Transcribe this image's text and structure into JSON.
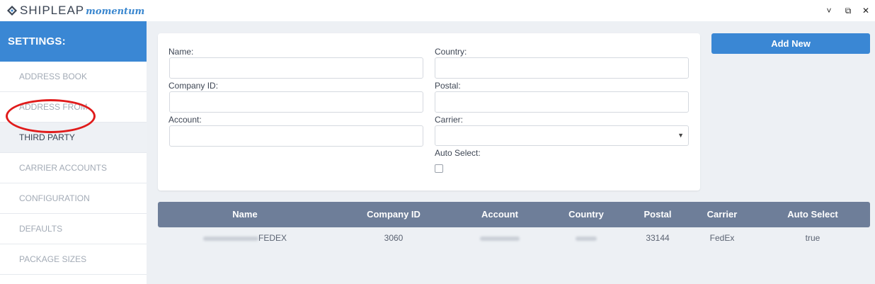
{
  "app": {
    "brand": "SHIPLEAP",
    "brand_sub": "momentum",
    "window_controls": {
      "minimize": "˅",
      "restore": "⧉",
      "close": "✕"
    }
  },
  "sidebar": {
    "title": "SETTINGS:",
    "items": [
      {
        "label": "ADDRESS BOOK"
      },
      {
        "label": "ADDRESS FROM"
      },
      {
        "label": "THIRD PARTY"
      },
      {
        "label": "CARRIER ACCOUNTS"
      },
      {
        "label": "CONFIGURATION"
      },
      {
        "label": "DEFAULTS"
      },
      {
        "label": "PACKAGE SIZES"
      }
    ],
    "active_index": 2
  },
  "form": {
    "name_label": "Name:",
    "name_value": "",
    "company_id_label": "Company ID:",
    "company_id_value": "",
    "account_label": "Account:",
    "account_value": "",
    "country_label": "Country:",
    "country_value": "",
    "postal_label": "Postal:",
    "postal_value": "",
    "carrier_label": "Carrier:",
    "carrier_value": "",
    "auto_select_label": "Auto Select:",
    "auto_select_checked": false
  },
  "add_button": {
    "label": "Add New"
  },
  "table": {
    "columns": [
      "Name",
      "Company ID",
      "Account",
      "Country",
      "Postal",
      "Carrier",
      "Auto Select"
    ],
    "rows": [
      {
        "name": "FEDEX",
        "company_id": "3060",
        "account": "",
        "country": "",
        "postal": "33144",
        "carrier": "FedEx",
        "auto_select": "true"
      }
    ]
  },
  "colors": {
    "accent": "#3a87d4",
    "table_header": "#6e7e99",
    "highlight_circle": "#e01b1b"
  }
}
